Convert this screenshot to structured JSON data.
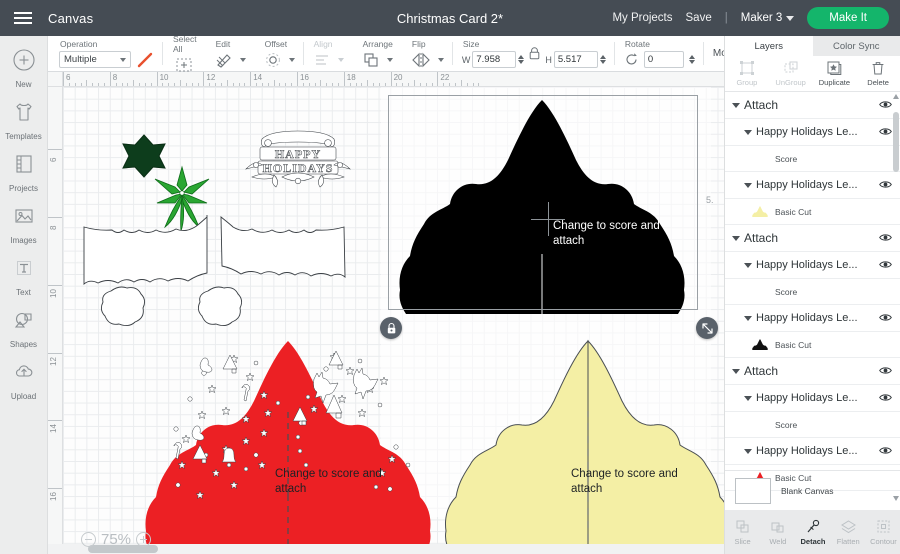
{
  "topbar": {
    "menu_icon": "hamburger-icon",
    "canvas_label": "Canvas",
    "project_title": "Christmas Card 2*",
    "my_projects": "My Projects",
    "save": "Save",
    "separator": "|",
    "machine": "Maker 3",
    "make_it": "Make It",
    "accent_green": "#14b56b",
    "bar_color": "#454c54"
  },
  "editbar": {
    "operation_label": "Operation",
    "operation_value": "Multiple",
    "stroke_color": "#e8502e",
    "select_all_label": "Select All",
    "edit_label": "Edit",
    "offset_label": "Offset",
    "align_label": "Align",
    "arrange_label": "Arrange",
    "flip_label": "Flip",
    "size_label": "Size",
    "width_key": "W",
    "width_value": "7.958",
    "height_key": "H",
    "height_value": "5.517",
    "rotate_label": "Rotate",
    "rotate_value": "0",
    "more_label": "More"
  },
  "leftbar": {
    "items": [
      {
        "label": "New",
        "icon": "plus-circle-icon"
      },
      {
        "label": "Templates",
        "icon": "tshirt-icon"
      },
      {
        "label": "Projects",
        "icon": "projects-icon"
      },
      {
        "label": "Images",
        "icon": "image-icon"
      },
      {
        "label": "Text",
        "icon": "text-icon"
      },
      {
        "label": "Shapes",
        "icon": "shapes-icon"
      },
      {
        "label": "Upload",
        "icon": "upload-cloud-icon"
      }
    ]
  },
  "canvas": {
    "ruler_h_labels": [
      "6",
      "8",
      "10",
      "12",
      "14",
      "16",
      "18",
      "20",
      "22"
    ],
    "ruler_v_labels": [
      "6",
      "8",
      "10",
      "12",
      "14",
      "16"
    ],
    "zoom_level": "75%",
    "zoom_out_icon": "minus-circle-icon",
    "zoom_in_icon": "plus-circle-icon",
    "selection": {
      "lock_icon": "lock-icon",
      "resize_icon": "resize-handle-icon",
      "dimension_label": "5."
    },
    "objects": [
      {
        "name": "dark-green-star",
        "color": "#0d3d1c"
      },
      {
        "name": "green-poinsettia",
        "color": "#2aa632"
      },
      {
        "name": "happy-holidays-title",
        "color": "#ffffff"
      },
      {
        "name": "white-card-panel-left",
        "color": "#ffffff"
      },
      {
        "name": "white-card-panel-right",
        "color": "#ffffff"
      },
      {
        "name": "white-blob-left",
        "color": "#ffffff"
      },
      {
        "name": "white-blob-right",
        "color": "#ffffff"
      },
      {
        "name": "black-tree-card",
        "color": "#000000",
        "note": "Change to score and attach"
      },
      {
        "name": "red-tree-card",
        "color": "#ec2024",
        "note": "Change to score and attach"
      },
      {
        "name": "yellow-tree-card",
        "color": "#f4efa5",
        "note": "Change to score and attach"
      }
    ],
    "note_text_line1": "Change to score and",
    "note_text_line2": "attach"
  },
  "rightpanel": {
    "tabs": [
      {
        "label": "Layers",
        "active": true
      },
      {
        "label": "Color Sync",
        "active": false
      }
    ],
    "actions": [
      {
        "label": "Group",
        "icon": "group-icon",
        "enabled": false
      },
      {
        "label": "UnGroup",
        "icon": "ungroup-icon",
        "enabled": false
      },
      {
        "label": "Duplicate",
        "icon": "duplicate-icon",
        "enabled": true
      },
      {
        "label": "Delete",
        "icon": "trash-icon",
        "enabled": true
      }
    ],
    "groups": [
      {
        "title": "Attach",
        "eye_icon": "eye-icon",
        "children": [
          {
            "title": "Happy Holidays Le...",
            "eye_icon": "eye-icon",
            "layer": {
              "label": "Score",
              "type": "score",
              "color": null
            }
          },
          {
            "title": "Happy Holidays Le...",
            "eye_icon": "eye-icon",
            "layer": {
              "label": "Basic Cut",
              "type": "cut",
              "color": "#f4efa5"
            }
          }
        ]
      },
      {
        "title": "Attach",
        "eye_icon": "eye-icon",
        "children": [
          {
            "title": "Happy Holidays Le...",
            "eye_icon": "eye-icon",
            "layer": {
              "label": "Score",
              "type": "score",
              "color": null
            }
          },
          {
            "title": "Happy Holidays Le...",
            "eye_icon": "eye-icon",
            "layer": {
              "label": "Basic Cut",
              "type": "cut",
              "color": "#111111"
            }
          }
        ]
      },
      {
        "title": "Attach",
        "eye_icon": "eye-icon",
        "children": [
          {
            "title": "Happy Holidays Le...",
            "eye_icon": "eye-icon",
            "layer": {
              "label": "Score",
              "type": "score",
              "color": null
            }
          },
          {
            "title": "Happy Holidays Le...",
            "eye_icon": "eye-icon",
            "layer": {
              "label": "Basic Cut",
              "type": "cut",
              "color": "#ec2024"
            }
          }
        ]
      }
    ],
    "blank_canvas": {
      "label": "Blank Canvas"
    },
    "bottom_tools": [
      {
        "label": "Slice",
        "icon": "slice-icon",
        "enabled": false
      },
      {
        "label": "Weld",
        "icon": "weld-icon",
        "enabled": false
      },
      {
        "label": "Detach",
        "icon": "detach-icon",
        "enabled": true
      },
      {
        "label": "Flatten",
        "icon": "flatten-icon",
        "enabled": false
      },
      {
        "label": "Contour",
        "icon": "contour-icon",
        "enabled": false
      }
    ]
  }
}
